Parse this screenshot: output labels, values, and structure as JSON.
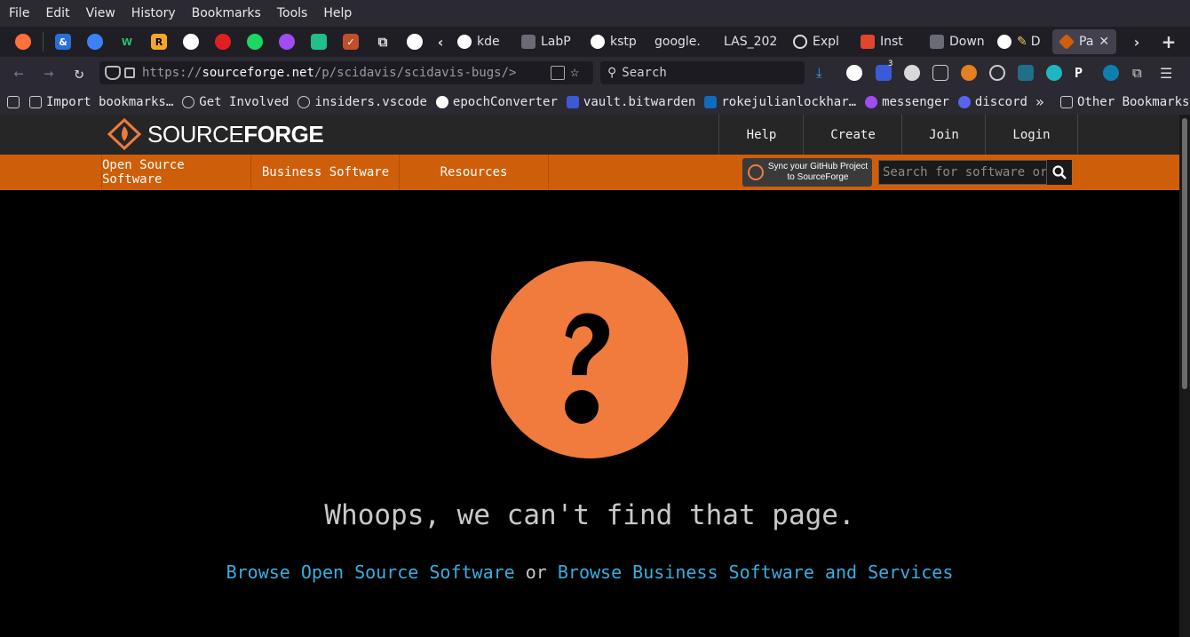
{
  "menubar": {
    "items": [
      "File",
      "Edit",
      "View",
      "History",
      "Bookmarks",
      "Tools",
      "Help"
    ]
  },
  "tabs": [
    {
      "label": "kde"
    },
    {
      "label": "LabP"
    },
    {
      "label": "kstp"
    },
    {
      "label": "google."
    },
    {
      "label": "LAS_202"
    },
    {
      "label": "Expl"
    },
    {
      "label": "Inst"
    },
    {
      "label": "Down"
    },
    {
      "label": "D"
    },
    {
      "label": "Pa"
    }
  ],
  "navbar": {
    "url_prefix": "https://",
    "url_domain": "sourceforge.net",
    "url_path": "/p/scidavis/scidavis-bugs/>",
    "search_placeholder": "Search",
    "badge_count": "3"
  },
  "bookmarks": {
    "items": [
      "Import bookmarks…",
      "Get Involved",
      "insiders.vscode",
      "epochConverter",
      "vault.bitwarden",
      "rokejulianlockhar…",
      "messenger",
      "discord"
    ],
    "other": "Other Bookmarks"
  },
  "site": {
    "logo_light": "SOURCE",
    "logo_bold": "FORGE",
    "topnav": [
      "Help",
      "Create",
      "Join",
      "Login"
    ],
    "subnav": [
      "Open Source Software",
      "Business Software",
      "Resources"
    ],
    "sync_line1": "Sync your GitHub Project",
    "sync_line2": "to SourceForge",
    "search_placeholder": "Search for software or solutions"
  },
  "main": {
    "error_title": "Whoops, we can't find that page.",
    "link1": "Browse Open Source Software",
    "or_text": "or",
    "link2": "Browse Business Software and Services"
  },
  "colors": {
    "brand_orange": "#cf5e0a",
    "circle_orange": "#f07b3d",
    "link_blue": "#3aaee0"
  }
}
